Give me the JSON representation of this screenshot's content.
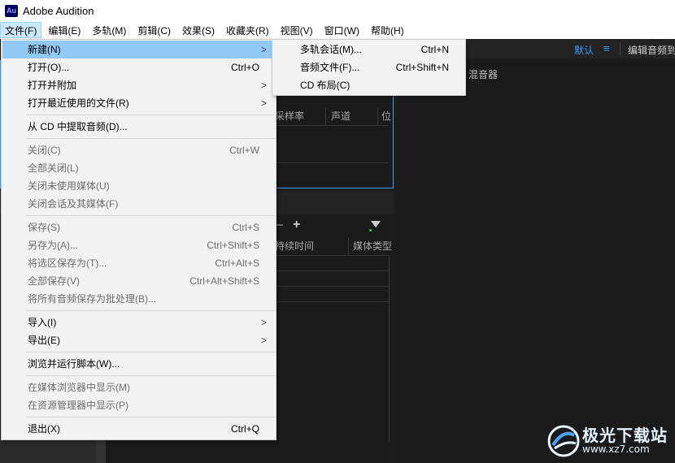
{
  "window": {
    "title": "Adobe Audition",
    "logo_text": "Au"
  },
  "menubar": {
    "items": [
      {
        "label": "文件(F)",
        "active": true
      },
      {
        "label": "编辑(E)"
      },
      {
        "label": "多轨(M)"
      },
      {
        "label": "剪辑(C)"
      },
      {
        "label": "效果(S)"
      },
      {
        "label": "收藏夹(R)"
      },
      {
        "label": "视图(V)"
      },
      {
        "label": "窗口(W)"
      },
      {
        "label": "帮助(H)"
      }
    ]
  },
  "workspace": {
    "default_label": "默认",
    "menu_icon": "≡",
    "edit_label": "编辑音频到"
  },
  "files_panel": {
    "columns": [
      "采样率",
      "声道",
      "位"
    ]
  },
  "media_panel": {
    "columns": [
      "持续时间",
      "媒体类型"
    ]
  },
  "right_panel": {
    "mixer_label": "混音器"
  },
  "file_menu": {
    "items": [
      {
        "label": "新建(N)",
        "shortcut": "",
        "submenu": true,
        "highlight": true
      },
      {
        "label": "打开(O)...",
        "shortcut": "Ctrl+O"
      },
      {
        "label": "打开并附加",
        "shortcut": "",
        "submenu": true
      },
      {
        "label": "打开最近使用的文件(R)",
        "shortcut": "",
        "submenu": true
      },
      {
        "label": "从 CD 中提取音频(D)...",
        "shortcut": ""
      },
      {
        "label": "关闭(C)",
        "shortcut": "Ctrl+W",
        "disabled": true
      },
      {
        "label": "全部关闭(L)",
        "shortcut": "",
        "disabled": true
      },
      {
        "label": "关闭未使用媒体(U)",
        "shortcut": "",
        "disabled": true
      },
      {
        "label": "关闭会话及其媒体(F)",
        "shortcut": "",
        "disabled": true
      },
      {
        "label": "保存(S)",
        "shortcut": "Ctrl+S",
        "disabled": true
      },
      {
        "label": "另存为(A)...",
        "shortcut": "Ctrl+Shift+S",
        "disabled": true
      },
      {
        "label": "将选区保存为(T)...",
        "shortcut": "Ctrl+Alt+S",
        "disabled": true
      },
      {
        "label": "全部保存(V)",
        "shortcut": "Ctrl+Alt+Shift+S",
        "disabled": true
      },
      {
        "label": "将所有音频保存为批处理(B)...",
        "shortcut": "",
        "disabled": true
      },
      {
        "label": "导入(I)",
        "shortcut": "",
        "submenu": true
      },
      {
        "label": "导出(E)",
        "shortcut": "",
        "submenu": true
      },
      {
        "label": "浏览并运行脚本(W)...",
        "shortcut": ""
      },
      {
        "label": "在媒体浏览器中显示(M)",
        "shortcut": "",
        "disabled": true
      },
      {
        "label": "在资源管理器中显示(P)",
        "shortcut": "",
        "disabled": true
      },
      {
        "label": "退出(X)",
        "shortcut": "Ctrl+Q"
      }
    ]
  },
  "new_submenu": {
    "items": [
      {
        "label": "多轨会话(M)...",
        "shortcut": "Ctrl+N"
      },
      {
        "label": "音频文件(F)...",
        "shortcut": "Ctrl+Shift+N"
      },
      {
        "label": "CD 布局(C)",
        "shortcut": ""
      }
    ]
  },
  "watermark": {
    "text": "极光下载站",
    "url": "www.xz7.com"
  },
  "colors": {
    "accent": "#3b9cff",
    "menu_highlight": "#91c9f7",
    "menubar_active": "#cce8ff"
  }
}
